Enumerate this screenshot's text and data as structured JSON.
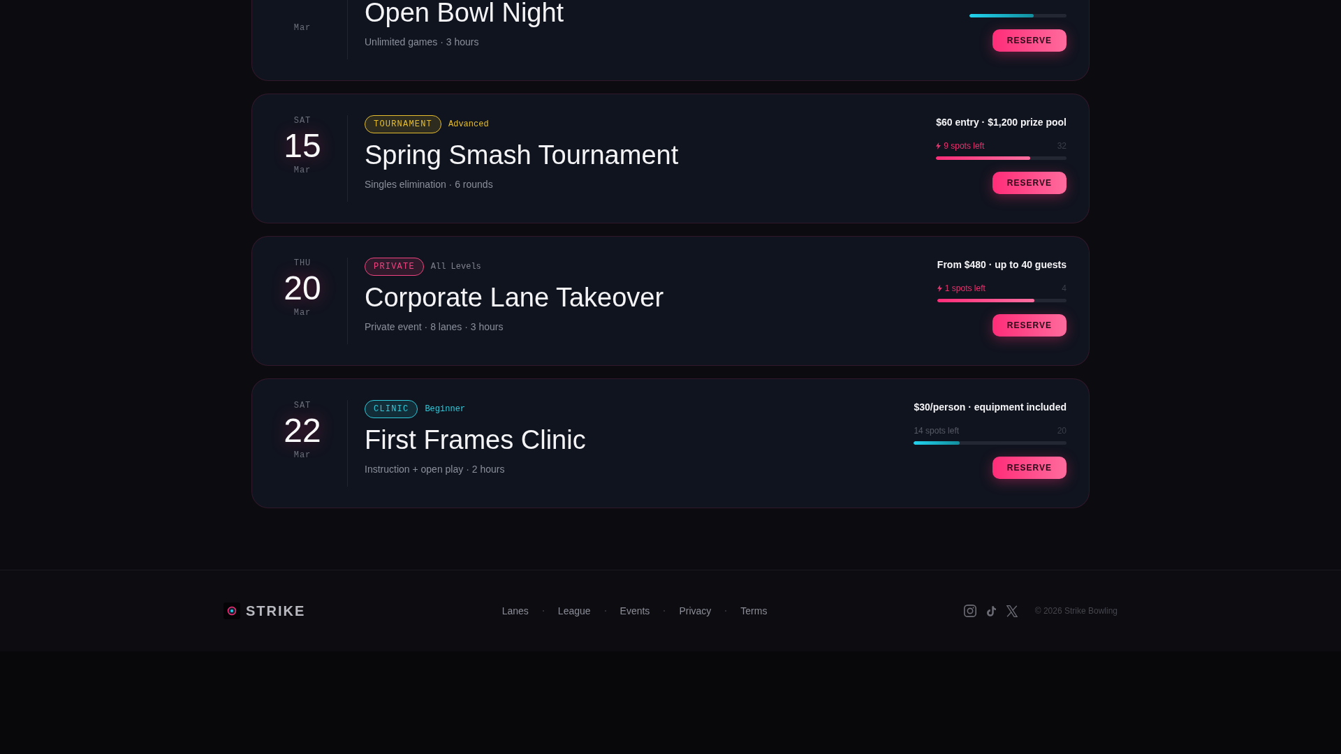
{
  "events": [
    {
      "date": {
        "month": "Mar"
      },
      "title": "Open Bowl Night",
      "details": "Unlimited games · 3 hours",
      "availability": {
        "urgent": false,
        "level": 0.66
      },
      "action": "RESERVE"
    },
    {
      "date": {
        "weekday": "SAT",
        "day": "15",
        "month": "Mar"
      },
      "tag": {
        "label": "TOURNAMENT",
        "color": "#e6bd2e"
      },
      "skill": {
        "label": "Advanced",
        "color": "#e6bd2e"
      },
      "title": "Spring Smash Tournament",
      "details": "Singles elimination · 6 rounds",
      "price": "$60 entry · $1,200 prize pool",
      "availability": {
        "urgent": true,
        "spots_left": "9 spots left",
        "capacity": "32",
        "level": 0.72
      },
      "action": "RESERVE"
    },
    {
      "date": {
        "weekday": "THU",
        "day": "20",
        "month": "Mar"
      },
      "tag": {
        "label": "PRIVATE",
        "color": "#f0437f"
      },
      "skill": {
        "label": "All Levels",
        "color": "#80838e"
      },
      "title": "Corporate Lane Takeover",
      "details": "Private event · 8 lanes · 3 hours",
      "price": "From $480 · up to 40 guests",
      "availability": {
        "urgent": true,
        "spots_left": "1 spots left",
        "capacity": "4",
        "level": 0.75
      },
      "action": "RESERVE"
    },
    {
      "date": {
        "weekday": "SAT",
        "day": "22",
        "month": "Mar"
      },
      "tag": {
        "label": "CLINIC",
        "color": "#2ec9da"
      },
      "skill": {
        "label": "Beginner",
        "color": "#2ec9da"
      },
      "title": "First Frames Clinic",
      "details": "Instruction + open play · 2 hours",
      "price": "$30/person · equipment included",
      "availability": {
        "urgent": false,
        "spots_left": "14 spots left",
        "capacity": "20",
        "level": 0.3
      },
      "action": "RESERVE"
    }
  ],
  "footer": {
    "brand": "STRIKE",
    "links": [
      "Lanes",
      "League",
      "Events",
      "Privacy",
      "Terms"
    ],
    "copyright": "© 2026 Strike Bowling"
  }
}
